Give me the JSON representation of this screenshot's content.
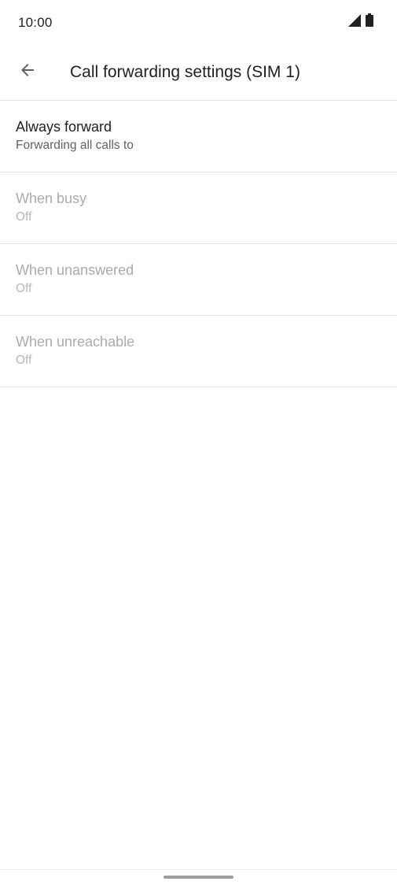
{
  "status_bar": {
    "time": "10:00",
    "icons": [
      "signal-icon",
      "battery-icon"
    ]
  },
  "app_bar": {
    "back_icon": "arrow-left-icon",
    "title": "Call forwarding settings (SIM 1)"
  },
  "list": {
    "items": [
      {
        "title": "Always forward",
        "summary": "Forwarding all calls to",
        "enabled": true
      },
      {
        "title": "When busy",
        "summary": "Off",
        "enabled": false
      },
      {
        "title": "When unanswered",
        "summary": "Off",
        "enabled": false
      },
      {
        "title": "When unreachable",
        "summary": "Off",
        "enabled": false
      }
    ]
  },
  "colors": {
    "text_primary": "#202124",
    "text_secondary": "#5f6368",
    "text_disabled": "#a8abaf",
    "divider": "#e3e3e3",
    "background": "#ffffff"
  }
}
